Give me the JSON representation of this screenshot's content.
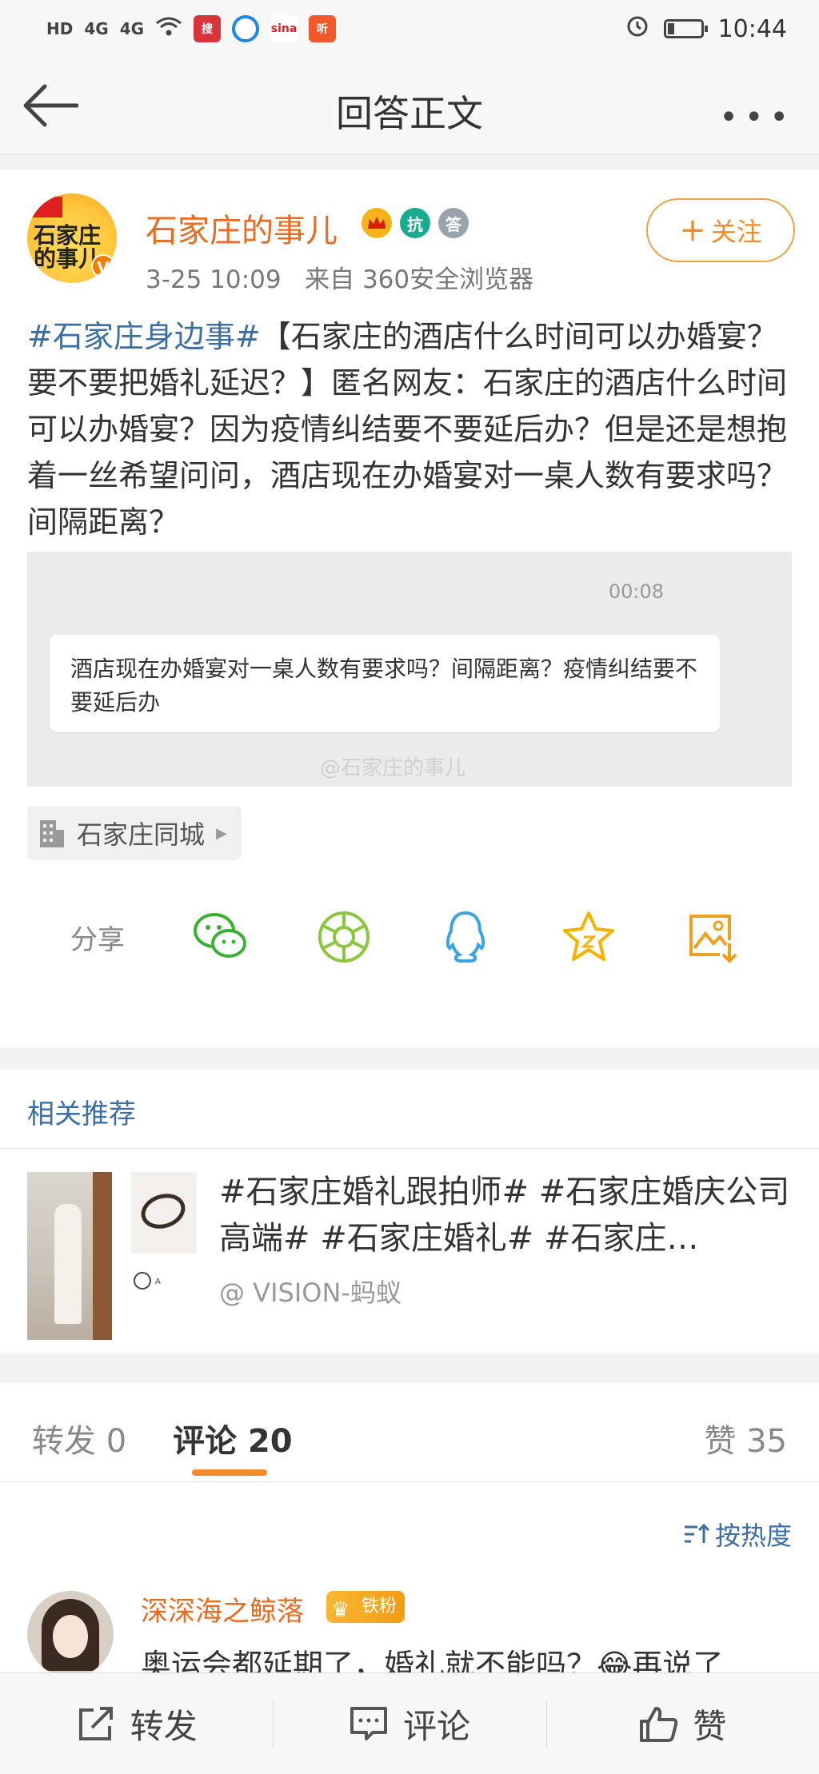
{
  "status_bar": {
    "left_chips": [
      "HD",
      "4G",
      "4G"
    ],
    "time": "10:44"
  },
  "header": {
    "title": "回答正文",
    "more": "•••"
  },
  "post": {
    "author": "石家庄的事儿",
    "timestamp": "3-25 10:09",
    "source": "来自 360安全浏览器",
    "follow_label": "关注",
    "avatar_text": "石家庄的事儿",
    "badges": [
      "crown",
      "抗",
      "答"
    ],
    "hashtag": "#石家庄身边事#",
    "body": "【石家庄的酒店什么时间可以办婚宴？要不要把婚礼延迟？】匿名网友：石家庄的酒店什么时间可以办婚宴？因为疫情纠结要不要延后办？但是还是想抱着一丝希望问问，酒店现在办婚宴对一桌人数有要求吗？间隔距离？",
    "media": {
      "time": "00:08",
      "message": "酒店现在办婚宴对一桌人数有要求吗？间隔距离？疫情纠结要不要延后办",
      "watermark": "@石家庄的事儿"
    },
    "location_chip": "石家庄同城",
    "share_label": "分享"
  },
  "related": {
    "heading": "相关推荐",
    "title": "#石家庄婚礼跟拍师# #石家庄婚庆公司高端# #石家庄婚礼# #石家庄…",
    "author": "@ VISION-蚂蚁"
  },
  "tabs": {
    "repost": "转发 0",
    "comments": "评论 20",
    "likes": "赞 35"
  },
  "comments": {
    "sort_label": "按热度",
    "first": {
      "name": "深深海之鲸落",
      "badge": "铁粉",
      "text": "奥运会都延期了，婚礼就不能吗？😂再说了"
    }
  },
  "bottom_bar": {
    "repost": "转发",
    "comment": "评论",
    "like": "赞"
  },
  "colors": {
    "accent_orange": "#f08c2c",
    "author_orange": "#e86b1f",
    "link_blue": "#3b6ea5"
  }
}
